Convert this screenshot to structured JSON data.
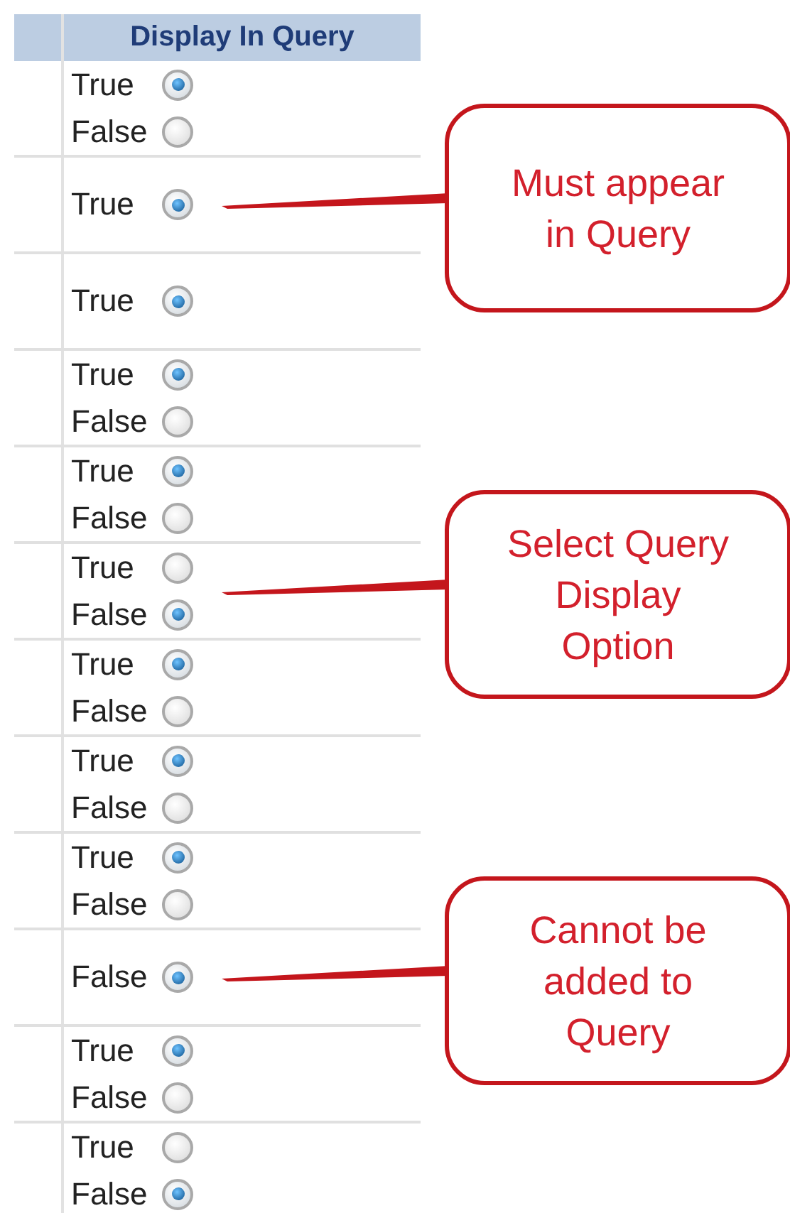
{
  "table": {
    "header": "Display In Query",
    "rows": [
      {
        "options": [
          {
            "label": "True",
            "selected": true
          },
          {
            "label": "False",
            "selected": false
          }
        ]
      },
      {
        "options": [
          {
            "label": "True",
            "selected": true
          }
        ],
        "callout": "Must appear\nin Query"
      },
      {
        "options": [
          {
            "label": "True",
            "selected": true
          }
        ]
      },
      {
        "options": [
          {
            "label": "True",
            "selected": true
          },
          {
            "label": "False",
            "selected": false
          }
        ]
      },
      {
        "options": [
          {
            "label": "True",
            "selected": true
          },
          {
            "label": "False",
            "selected": false
          }
        ]
      },
      {
        "options": [
          {
            "label": "True",
            "selected": false
          },
          {
            "label": "False",
            "selected": true
          }
        ],
        "callout": "Select Query\nDisplay\nOption"
      },
      {
        "options": [
          {
            "label": "True",
            "selected": true
          },
          {
            "label": "False",
            "selected": false
          }
        ]
      },
      {
        "options": [
          {
            "label": "True",
            "selected": true
          },
          {
            "label": "False",
            "selected": false
          }
        ]
      },
      {
        "options": [
          {
            "label": "True",
            "selected": true
          },
          {
            "label": "False",
            "selected": false
          }
        ]
      },
      {
        "options": [
          {
            "label": "False",
            "selected": true
          }
        ],
        "callout": "Cannot be\nadded to\nQuery"
      },
      {
        "options": [
          {
            "label": "True",
            "selected": true
          },
          {
            "label": "False",
            "selected": false
          }
        ]
      },
      {
        "options": [
          {
            "label": "True",
            "selected": false
          },
          {
            "label": "False",
            "selected": true
          }
        ]
      }
    ]
  }
}
